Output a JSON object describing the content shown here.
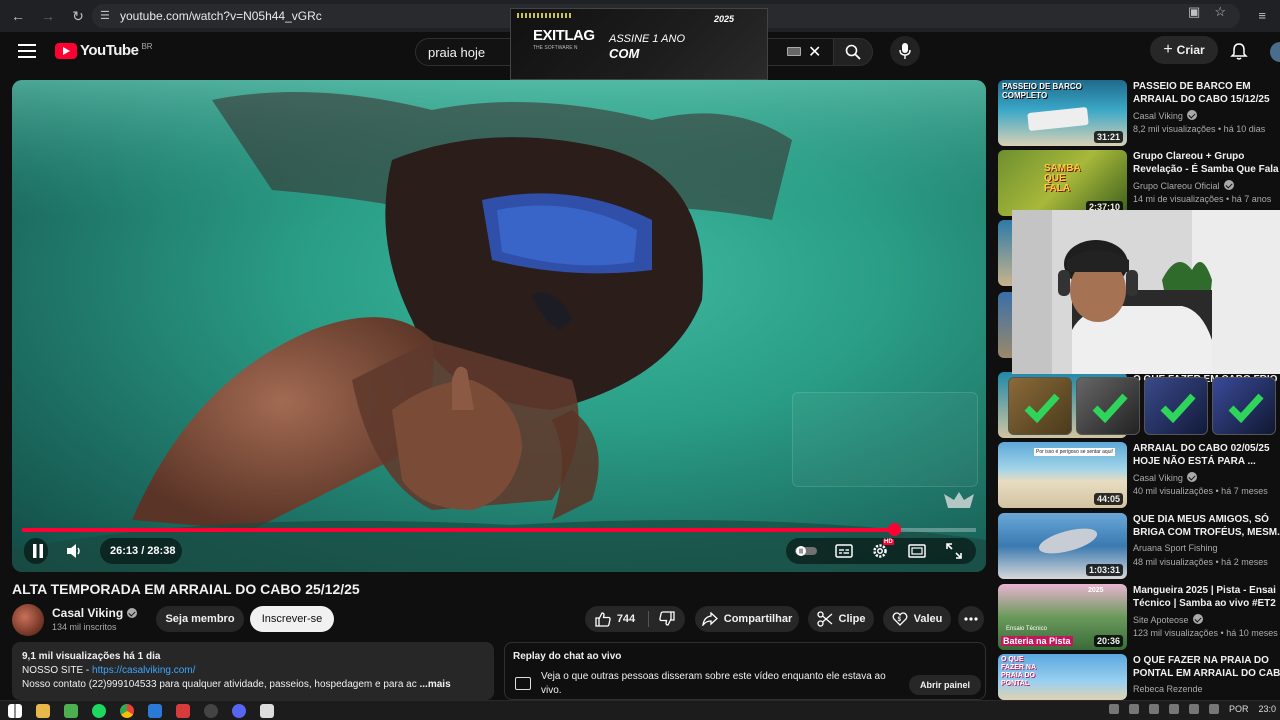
{
  "browser": {
    "url": "youtube.com/watch?v=N05h44_vGRc"
  },
  "masthead": {
    "logo_text": "YouTube",
    "region": "BR",
    "search_value": "praia hoje",
    "create_label": "Criar"
  },
  "ad": {
    "brand": "EXITLAG",
    "tagline": "THE SOFTWARE N",
    "line1": "ASSINE 1 ANO",
    "line2": "COM",
    "badge": "2025"
  },
  "player": {
    "time_current": "26:13",
    "time_total": "28:38",
    "time_display": "26:13 / 28:38",
    "progress_fraction": 0.9138,
    "hd_badge": "HD",
    "watermark_text": "Casal Viking"
  },
  "video": {
    "title": "ALTA TEMPORADA EM ARRAIAL DO CABO 25/12/25",
    "channel_name": "Casal Viking",
    "subscribers": "134 mil inscritos",
    "member_label": "Seja membro",
    "subscribe_label": "Inscrever-se",
    "likes": "744",
    "share_label": "Compartilhar",
    "clip_label": "Clipe",
    "thanks_label": "Valeu"
  },
  "description": {
    "meta": "9,1 mil visualizações  há 1 dia",
    "site_prefix": "NOSSO SITE - ",
    "site_link": "https://casalviking.com/",
    "contact": "Nosso contato (22)999104533 para qualquer atividade, passeios, hospedagem e para ac",
    "more": "...mais"
  },
  "chat_replay": {
    "heading": "Replay do chat ao vivo",
    "body": "Veja o que outras pessoas disseram sobre este vídeo enquanto ele estava ao vivo.",
    "button": "Abrir painel"
  },
  "sidebar": {
    "items": [
      {
        "thumb_caption": "PASSEIO DE BARCO COMPLETO",
        "title_line1": "PASSEIO DE BARCO EM",
        "title_line2": "ARRAIAL DO CABO 15/12/25",
        "channel": "Casal Viking",
        "verified": true,
        "meta": "8,2 mil visualizações • há 10 dias",
        "duration": "31:21"
      },
      {
        "thumb_caption": "SAMBA QUE FALA",
        "title_line1": "Grupo Clareou + Grupo",
        "title_line2": "Revelação - É Samba Que Fala",
        "channel": "Grupo Clareou Oficial",
        "verified": true,
        "meta": "14 mi de visualizações • há 7 anos",
        "duration": "2:37:10"
      },
      {
        "title_line1": "O QUE FAZER EM CABO FRIO",
        "title_line2": "",
        "channel": "",
        "verified": false,
        "meta": "",
        "duration": ""
      },
      {
        "thumb_caption": "Por isso é perigoso se sentar aqui!",
        "title_line1": "ARRAIAL DO CABO 02/05/25",
        "title_line2": "HOJE NÃO ESTÁ PARA ...",
        "channel": "Casal Viking",
        "verified": true,
        "meta": "40 mil visualizações • há 7 meses",
        "duration": "44:05"
      },
      {
        "title_line1": "QUE DIA MEUS AMIGOS, SÓ",
        "title_line2": "BRIGA COM TROFÉUS, MESM.",
        "channel": "Aruana Sport Fishing",
        "verified": false,
        "meta": "48 mil visualizações • há 2 meses",
        "duration": "1:03:31"
      },
      {
        "thumb_caption": "Bateria na Pista",
        "thumb_year": "2025",
        "thumb_sub": "Ensaio Técnico",
        "title_line1": "Mangueira 2025 | Pista - Ensai",
        "title_line2": "Técnico | Samba ao vivo #ET2",
        "channel": "Site Apoteose",
        "verified": true,
        "meta": "123 mil visualizações • há 10 meses",
        "duration": "20:36"
      },
      {
        "thumb_caption": "O QUE FAZER NA PRAIA DO PONTAL",
        "title_line1": "O QUE FAZER NA PRAIA DO",
        "title_line2": "PONTAL EM ARRAIAL DO CAB",
        "channel": "Rebeca Rezende",
        "verified": false,
        "meta": "",
        "duration": ""
      }
    ]
  },
  "taskbar": {
    "language": "POR",
    "clock": "23:0"
  },
  "colors": {
    "accent_red": "#ff0033",
    "background": "#0f0f0f",
    "surface": "#272727",
    "link_blue": "#3ea6ff"
  }
}
